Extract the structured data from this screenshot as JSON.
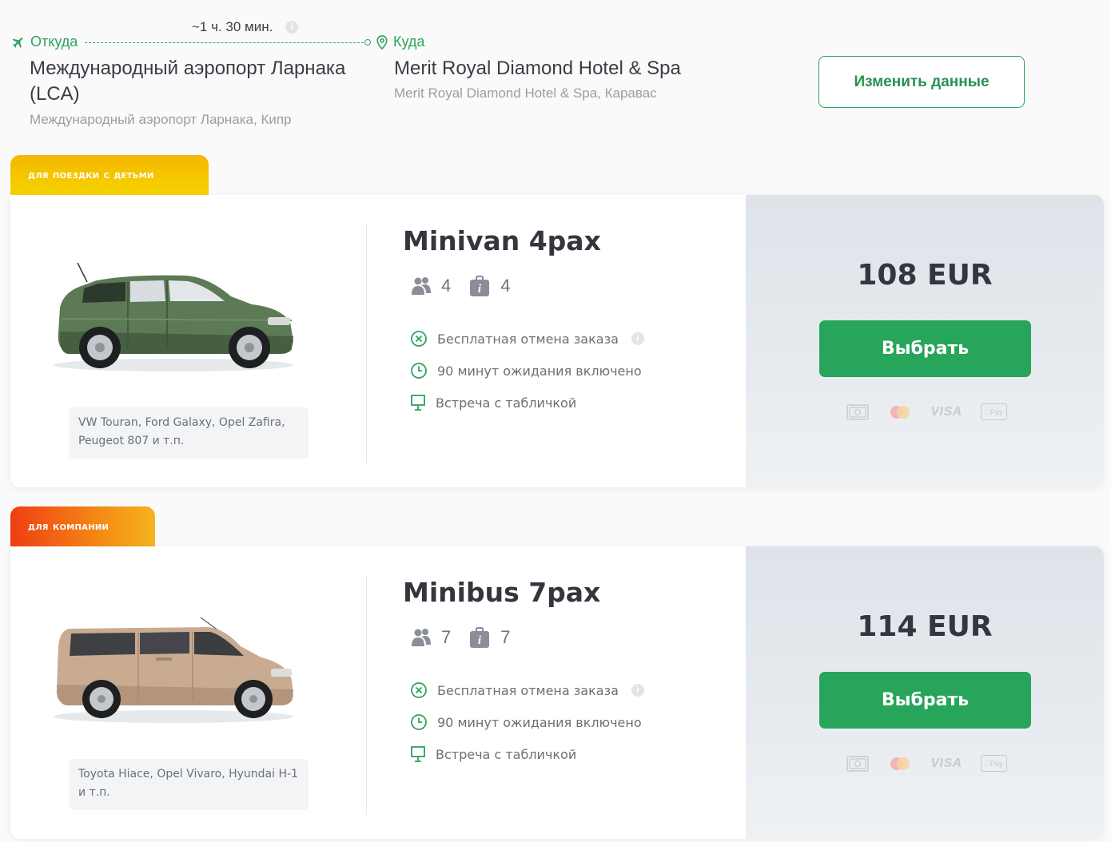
{
  "route": {
    "duration": "~1 ч. 30 мин.",
    "from": {
      "label": "Откуда",
      "title": "Международный аэропорт Ларнака (LCA)",
      "subtitle": "Международный аэропорт Ларнака, Кипр"
    },
    "to": {
      "label": "Куда",
      "title": "Merit Royal Diamond Hotel & Spa",
      "subtitle": "Merit Royal Diamond Hotel & Spa, Каравас"
    },
    "change_button": "Изменить данные"
  },
  "colors": {
    "accent_green": "#27a55a",
    "badge_kids": "#f5c400",
    "badge_company": "#ef3d12"
  },
  "offers": [
    {
      "badge": "для поездки с детьми",
      "car_name": "Minivan 4pax",
      "car_color": "green",
      "models": "VW Touran, Ford Galaxy, Opel Zafira, Peugeot 807 и т.п.",
      "passengers": "4",
      "luggage": "4",
      "features": [
        {
          "icon": "cancel-icon",
          "text": "Бесплатная отмена заказа"
        },
        {
          "icon": "clock-icon",
          "text": "90 минут ожидания включено"
        },
        {
          "icon": "sign-icon",
          "text": "Встреча с табличкой"
        }
      ],
      "price": "108 EUR",
      "select_button": "Выбрать",
      "payments": [
        "cash-icon",
        "mastercard-icon",
        "VISA",
        "Pay"
      ]
    },
    {
      "badge": "для компании",
      "car_name": "Minibus 7pax",
      "car_color": "beige",
      "models": "Toyota Hiace, Opel Vivaro, Hyundai H-1 и т.п.",
      "passengers": "7",
      "luggage": "7",
      "features": [
        {
          "icon": "cancel-icon",
          "text": "Бесплатная отмена заказа"
        },
        {
          "icon": "clock-icon",
          "text": "90 минут ожидания включено"
        },
        {
          "icon": "sign-icon",
          "text": "Встреча с табличкой"
        }
      ],
      "price": "114 EUR",
      "select_button": "Выбрать",
      "payments": [
        "cash-icon",
        "mastercard-icon",
        "VISA",
        "Pay"
      ]
    }
  ]
}
